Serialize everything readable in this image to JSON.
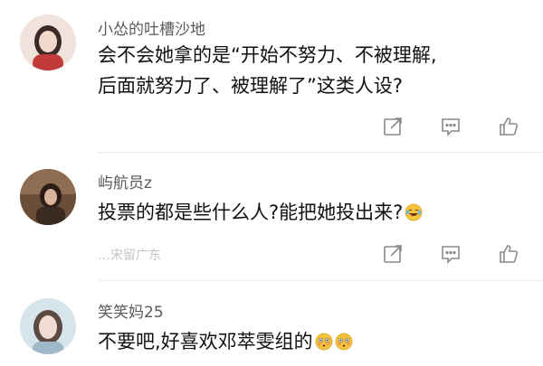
{
  "comments": [
    {
      "username": "小怂的吐槽沙地",
      "lines": [
        "会不会她拿的是“开始不努力、不被理解,",
        "后面就努力了、被理解了”这类人设?"
      ],
      "meta": ""
    },
    {
      "username": "屿航员z",
      "lines": [
        "投票的都是些什么人?能把她投出来?"
      ],
      "meta": "…宋留广东",
      "emoji": "laughing-tears-emoji"
    },
    {
      "username": "笑笑妈25",
      "lines": [
        "不要吧,好喜欢邓萃雯组的"
      ],
      "emoji": "flushed-emoji"
    }
  ],
  "colors": {
    "icon": "#8a8a8a",
    "divider": "#ececec",
    "username": "#5a5a5a",
    "text": "#111111"
  },
  "icons": [
    "share-icon",
    "comment-icon",
    "like-icon"
  ]
}
